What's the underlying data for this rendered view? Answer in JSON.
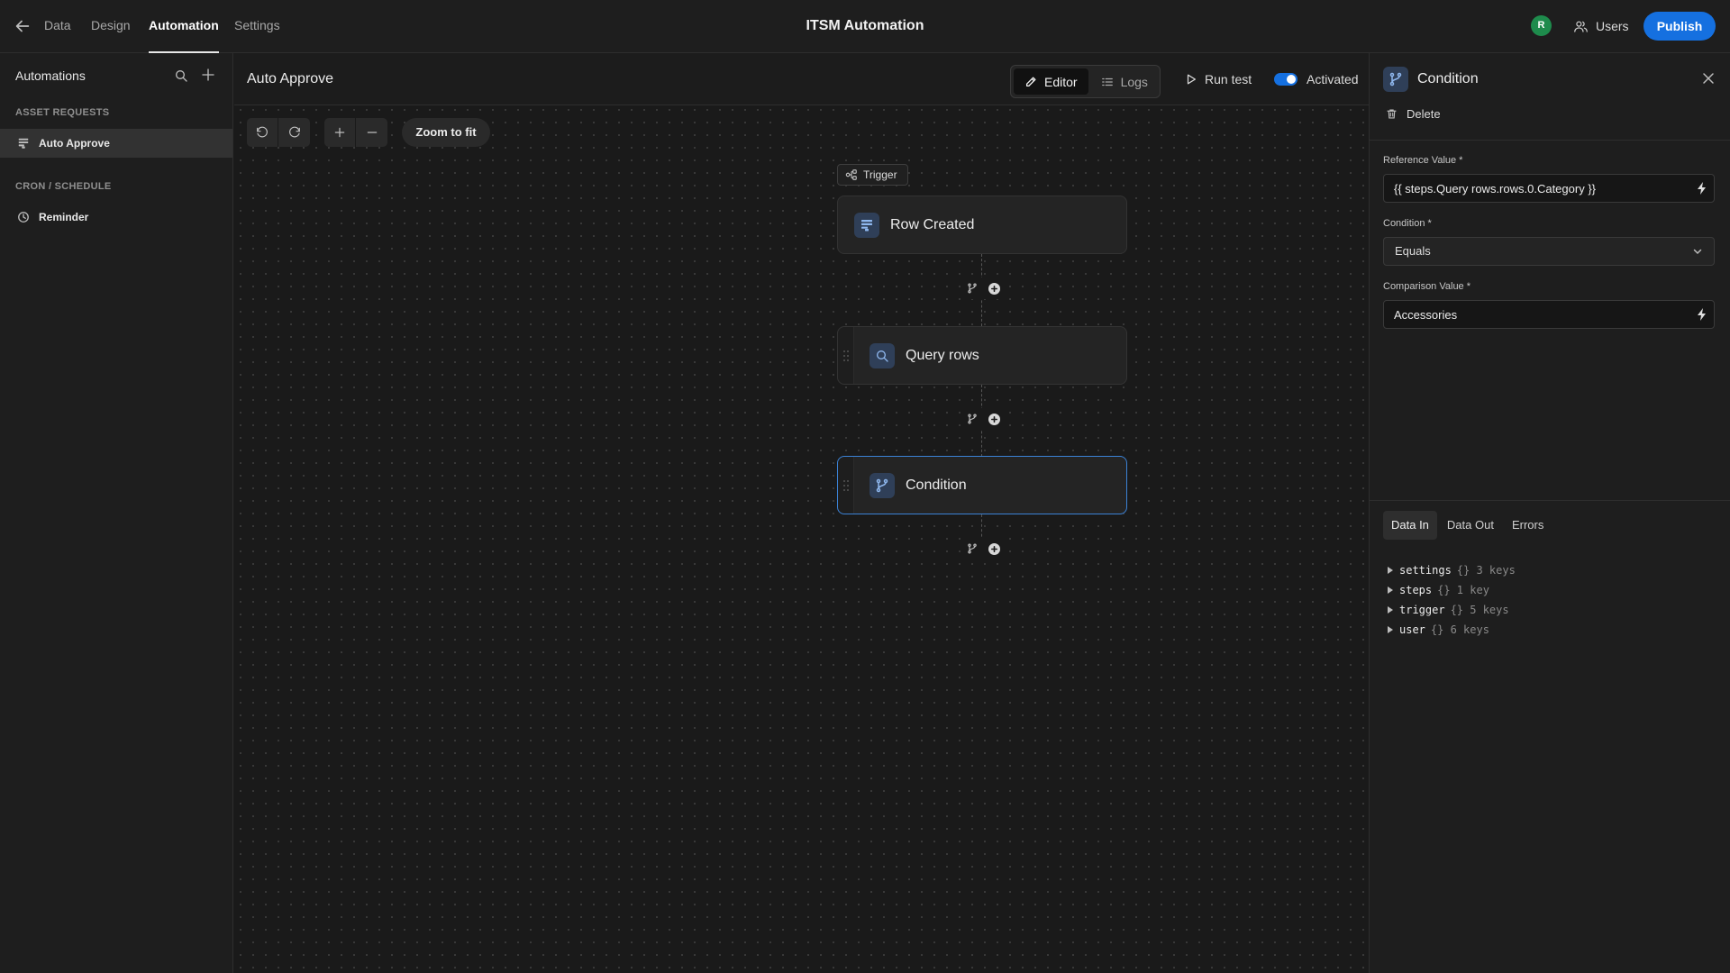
{
  "topbar": {
    "tabs": [
      {
        "label": "Data"
      },
      {
        "label": "Design"
      },
      {
        "label": "Automation"
      },
      {
        "label": "Settings"
      }
    ],
    "app_title": "ITSM Automation",
    "avatar_initial": "R",
    "users_label": "Users",
    "publish_label": "Publish"
  },
  "sidebar": {
    "title": "Automations",
    "sections": [
      {
        "heading": "ASSET REQUESTS",
        "items": [
          {
            "label": "Auto Approve",
            "icon": "row-icon",
            "selected": true
          }
        ]
      },
      {
        "heading": "CRON / SCHEDULE",
        "items": [
          {
            "label": "Reminder",
            "icon": "clock-icon",
            "selected": false
          }
        ]
      }
    ]
  },
  "canvas": {
    "automation_name": "Auto Approve",
    "modes": [
      {
        "label": "Editor",
        "active": true
      },
      {
        "label": "Logs",
        "active": false
      }
    ],
    "run_test_label": "Run test",
    "activated_label": "Activated",
    "activated": true,
    "zoom_to_fit_label": "Zoom to fit",
    "trigger_badge": "Trigger",
    "nodes": [
      {
        "label": "Row Created",
        "icon": "row-icon"
      },
      {
        "label": "Query rows",
        "icon": "search-icon"
      },
      {
        "label": "Condition",
        "icon": "branch-icon",
        "selected": true
      }
    ]
  },
  "panel": {
    "title": "Condition",
    "delete_label": "Delete",
    "fields": {
      "reference_label": "Reference Value *",
      "reference_value": "{{ steps.Query rows.rows.0.Category }}",
      "condition_label": "Condition *",
      "condition_value": "Equals",
      "comparison_label": "Comparison Value *",
      "comparison_value": "Accessories"
    },
    "tabs": [
      {
        "label": "Data In",
        "active": true
      },
      {
        "label": "Data Out",
        "active": false
      },
      {
        "label": "Errors",
        "active": false
      }
    ],
    "tree": [
      {
        "key": "settings",
        "meta": "{} 3 keys"
      },
      {
        "key": "steps",
        "meta": "{} 1 key"
      },
      {
        "key": "trigger",
        "meta": "{} 5 keys"
      },
      {
        "key": "user",
        "meta": "{} 6 keys"
      }
    ]
  },
  "colors": {
    "accent": "#1570e0",
    "selected_border": "#3b82d6",
    "avatar": "#1e8b4c"
  }
}
